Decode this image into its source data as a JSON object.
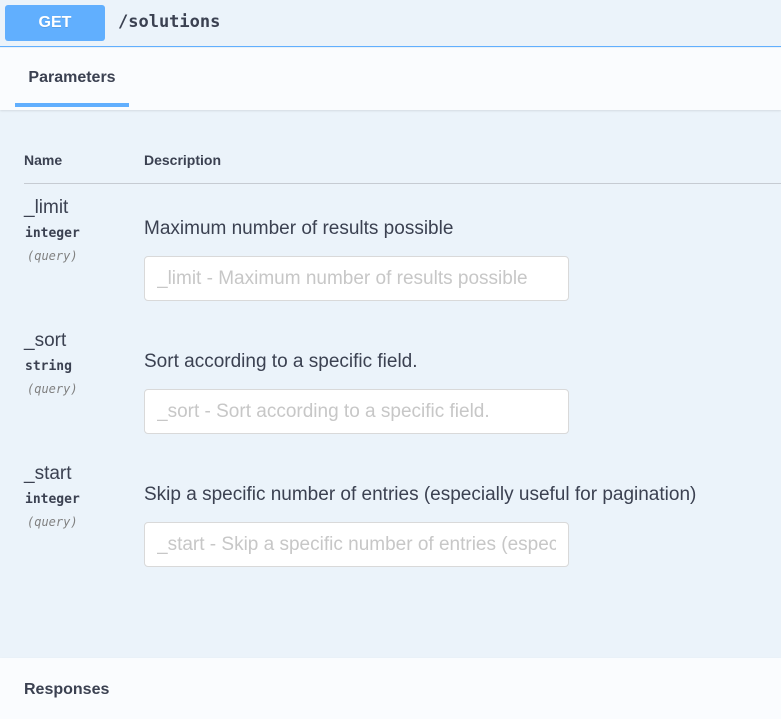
{
  "operation": {
    "method": "GET",
    "path": "/solutions",
    "method_color": "#61affe"
  },
  "tabs": {
    "parameters_label": "Parameters"
  },
  "columns": {
    "name": "Name",
    "description": "Description"
  },
  "parameters": [
    {
      "name": "_limit",
      "type": "integer",
      "in": "(query)",
      "description": "Maximum number of results possible",
      "placeholder": "_limit - Maximum number of results possible",
      "value": ""
    },
    {
      "name": "_sort",
      "type": "string",
      "in": "(query)",
      "description": "Sort according to a specific field.",
      "placeholder": "_sort - Sort according to a specific field.",
      "value": ""
    },
    {
      "name": "_start",
      "type": "integer",
      "in": "(query)",
      "description": "Skip a specific number of entries (especially useful for pagination)",
      "placeholder": "_start - Skip a specific number of entries (especially useful for pagination)",
      "value": ""
    }
  ],
  "responses": {
    "title": "Responses"
  }
}
